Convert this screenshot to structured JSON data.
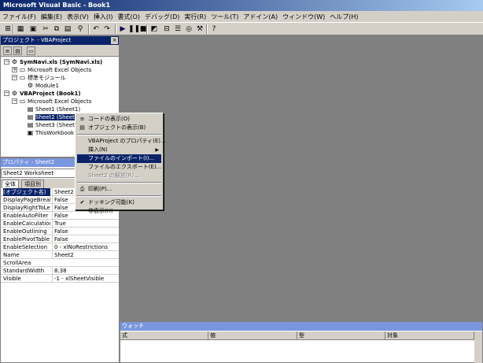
{
  "window": {
    "title": "Microsoft Visual Basic - Book1"
  },
  "menu": [
    "ファイル(F)",
    "編集(E)",
    "表示(V)",
    "挿入(I)",
    "書式(O)",
    "デバッグ(D)",
    "実行(R)",
    "ツール(T)",
    "アドイン(A)",
    "ウィンドウ(W)",
    "ヘルプ(H)"
  ],
  "toolbar": {
    "icons": [
      "excel-icon",
      "insert-module-icon",
      "save-icon",
      "cut-icon",
      "copy-icon",
      "paste-icon",
      "find-icon",
      "undo-icon",
      "redo-icon",
      "run-icon",
      "break-icon",
      "reset-icon",
      "design-mode-icon",
      "project-explorer-icon",
      "properties-icon",
      "object-browser-icon",
      "toolbox-icon",
      "help-icon"
    ]
  },
  "project": {
    "title": "プロジェクト - VBAProject",
    "close": "×",
    "tree": [
      {
        "label": "SymNavi.xls (SymNavi.xls)",
        "bold": true,
        "exp": "−"
      },
      {
        "label": "Microsoft Excel Objects",
        "exp": "+"
      },
      {
        "label": "標準モジュール",
        "exp": "−"
      },
      {
        "label": "Module1"
      },
      {
        "label": "VBAProject (Book1)",
        "bold": true,
        "exp": "−"
      },
      {
        "label": "Microsoft Excel Objects",
        "exp": "−"
      },
      {
        "label": "Sheet1 (Sheet1)"
      },
      {
        "label": "Sheet2 (Sheet2)",
        "selected": true
      },
      {
        "label": "Sheet3 (Sheet3)"
      },
      {
        "label": "ThisWorkbook"
      }
    ]
  },
  "properties": {
    "title": "プロパティ - Sheet2",
    "combo": "Sheet2 Worksheet",
    "tabs": [
      "全体",
      "項目別"
    ],
    "rows": [
      {
        "key": "(オブジェクト名)",
        "value": "Sheet2",
        "selected": true
      },
      {
        "key": "DisplayPageBreaks",
        "value": "False"
      },
      {
        "key": "DisplayRightToLeft",
        "value": "False"
      },
      {
        "key": "EnableAutoFilter",
        "value": "False"
      },
      {
        "key": "EnableCalculation",
        "value": "True"
      },
      {
        "key": "EnableOutlining",
        "value": "False"
      },
      {
        "key": "EnablePivotTable",
        "value": "False"
      },
      {
        "key": "EnableSelection",
        "value": "0 - xlNoRestrictions"
      },
      {
        "key": "Name",
        "value": "Sheet2"
      },
      {
        "key": "ScrollArea",
        "value": ""
      },
      {
        "key": "StandardWidth",
        "value": "8.38"
      },
      {
        "key": "Visible",
        "value": "-1 - xlSheetVisible"
      }
    ]
  },
  "watch": {
    "title": "ウォッチ",
    "columns": [
      "式",
      "値",
      "型",
      "対象"
    ]
  },
  "context_menu": {
    "items": [
      {
        "label": "コードの表示(O)",
        "icon": "code-icon"
      },
      {
        "label": "オブジェクトの表示(B)",
        "icon": "object-icon"
      },
      {
        "sep": true
      },
      {
        "label": "VBAProject のプロパティ(E)..."
      },
      {
        "label": "挿入(N)",
        "submenu": true
      },
      {
        "label": "ファイルのインポート(I)...",
        "highlighted": true
      },
      {
        "label": "ファイルのエクスポート(E)..."
      },
      {
        "label": "Sheet2 の解放(R)...",
        "disabled": true
      },
      {
        "sep": true
      },
      {
        "label": "印刷(P)...",
        "icon": "print-icon"
      },
      {
        "sep": true
      },
      {
        "label": "ドッキング可能(K)",
        "checked": true
      },
      {
        "label": "非表示(H)"
      }
    ]
  }
}
